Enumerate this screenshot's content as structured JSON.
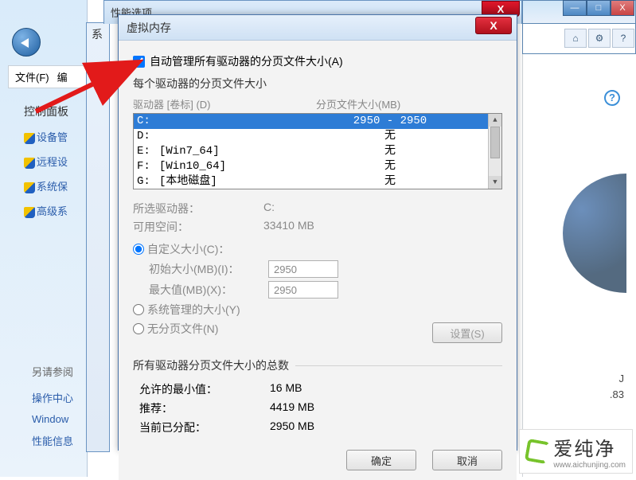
{
  "bg": {
    "min_label": "—",
    "max_label": "□",
    "close_label": "X",
    "tool_home": "⌂",
    "tool_gear": "⚙",
    "tool_help": "?",
    "right_text1": "J",
    "right_text2": ".83"
  },
  "ctrl": {
    "file": "文件(F)",
    "edit": "编",
    "home": "控制面板",
    "items": [
      "设备管",
      "远程设",
      "系统保",
      "高级系"
    ],
    "see_also": "另请参阅",
    "links": [
      "操作中心",
      "Window",
      "性能信息"
    ]
  },
  "syswin_title": "系",
  "perfwin_title": "性能选项",
  "perf_close": "X",
  "vm": {
    "title": "虚拟内存",
    "close": "X",
    "auto_manage": "自动管理所有驱动器的分页文件大小(A)",
    "each_drive": "每个驱动器的分页文件大小",
    "header_drive": "驱动器 [卷标] (D)",
    "header_size": "分页文件大小(MB)",
    "drives": [
      {
        "letter": "C:",
        "label": "",
        "size": "2950 - 2950",
        "selected": true
      },
      {
        "letter": "D:",
        "label": "",
        "size": "无"
      },
      {
        "letter": "E:",
        "label": "[Win7_64]",
        "size": "无"
      },
      {
        "letter": "F:",
        "label": "[Win10_64]",
        "size": "无"
      },
      {
        "letter": "G:",
        "label": "[本地磁盘]",
        "size": "无"
      }
    ],
    "selected_drive_label": "所选驱动器：",
    "selected_drive_value": "C:",
    "avail_space_label": "可用空间：",
    "avail_space_value": "33410 MB",
    "custom_size": "自定义大小(C)：",
    "initial_label": "初始大小(MB)(I)：",
    "initial_value": "2950",
    "max_label": "最大值(MB)(X)：",
    "max_value": "2950",
    "system_managed": "系统管理的大小(Y)",
    "no_paging": "无分页文件(N)",
    "set_btn": "设置(S)",
    "totals_legend": "所有驱动器分页文件大小的总数",
    "min_allowed_label": "允许的最小值：",
    "min_allowed_value": "16 MB",
    "recommended_label": "推荐：",
    "recommended_value": "4419 MB",
    "current_label": "当前已分配：",
    "current_value": "2950 MB",
    "ok": "确定",
    "cancel": "取消"
  },
  "watermark": {
    "big": "爱纯净",
    "small": "www.aichunjing.com"
  }
}
